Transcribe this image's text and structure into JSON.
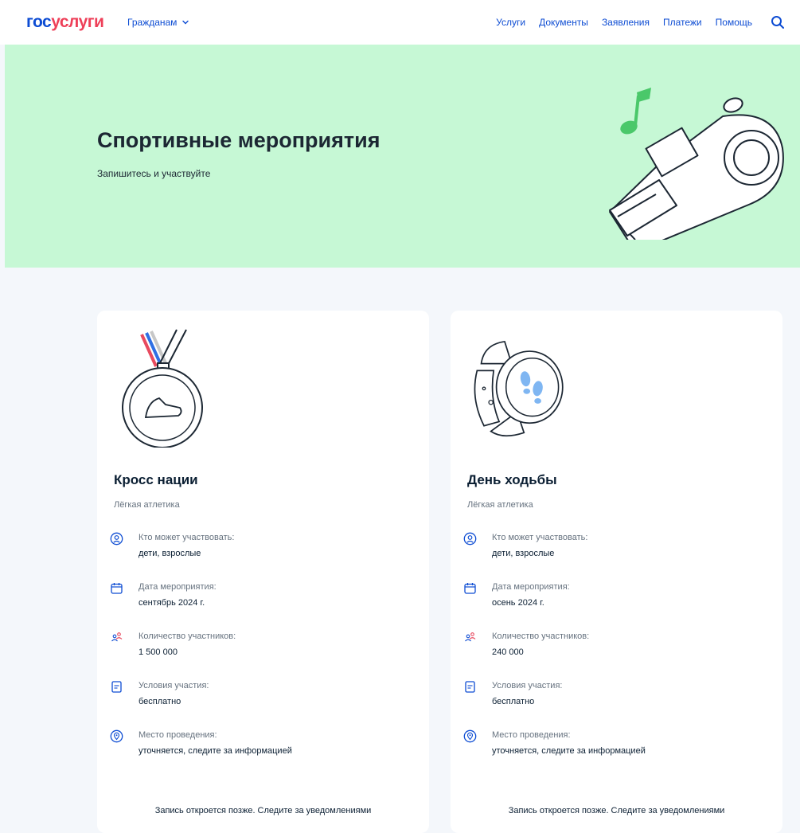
{
  "header": {
    "logo_part1": "гос",
    "logo_part2": "услуги",
    "role_label": "Гражданам",
    "nav": [
      "Услуги",
      "Документы",
      "Заявления",
      "Платежи",
      "Помощь"
    ]
  },
  "hero": {
    "title": "Спортивные мероприятия",
    "subtitle": "Запишитесь и участвуйте"
  },
  "cards": [
    {
      "title": "Кросс нации",
      "category": "Лёгкая атлетика",
      "info": [
        {
          "icon": "person-icon",
          "label": "Кто может участвовать:",
          "value": "дети, взрослые"
        },
        {
          "icon": "calendar-icon",
          "label": "Дата мероприятия:",
          "value": "сентябрь 2024 г."
        },
        {
          "icon": "people-icon",
          "label": "Количество участников:",
          "value": "1 500 000"
        },
        {
          "icon": "document-icon",
          "label": "Условия участия:",
          "value": "бесплатно"
        },
        {
          "icon": "location-icon",
          "label": "Место проведения:",
          "value": "уточняется, следите за информацией"
        }
      ],
      "footer": "Запись откроется позже. Следите за уведомлениями"
    },
    {
      "title": "День ходьбы",
      "category": "Лёгкая атлетика",
      "info": [
        {
          "icon": "person-icon",
          "label": "Кто может участвовать:",
          "value": "дети, взрослые"
        },
        {
          "icon": "calendar-icon",
          "label": "Дата мероприятия:",
          "value": "осень 2024 г."
        },
        {
          "icon": "people-icon",
          "label": "Количество участников:",
          "value": "240 000"
        },
        {
          "icon": "document-icon",
          "label": "Условия участия:",
          "value": "бесплатно"
        },
        {
          "icon": "location-icon",
          "label": "Место проведения:",
          "value": "уточняется, следите за информацией"
        }
      ],
      "footer": "Запись откроется позже. Следите за уведомлениями"
    }
  ],
  "colors": {
    "brand_blue": "#0d4cd3",
    "brand_red": "#ee3f58",
    "hero_bg": "#c6f8d5",
    "page_bg": "#f4f7fb"
  }
}
